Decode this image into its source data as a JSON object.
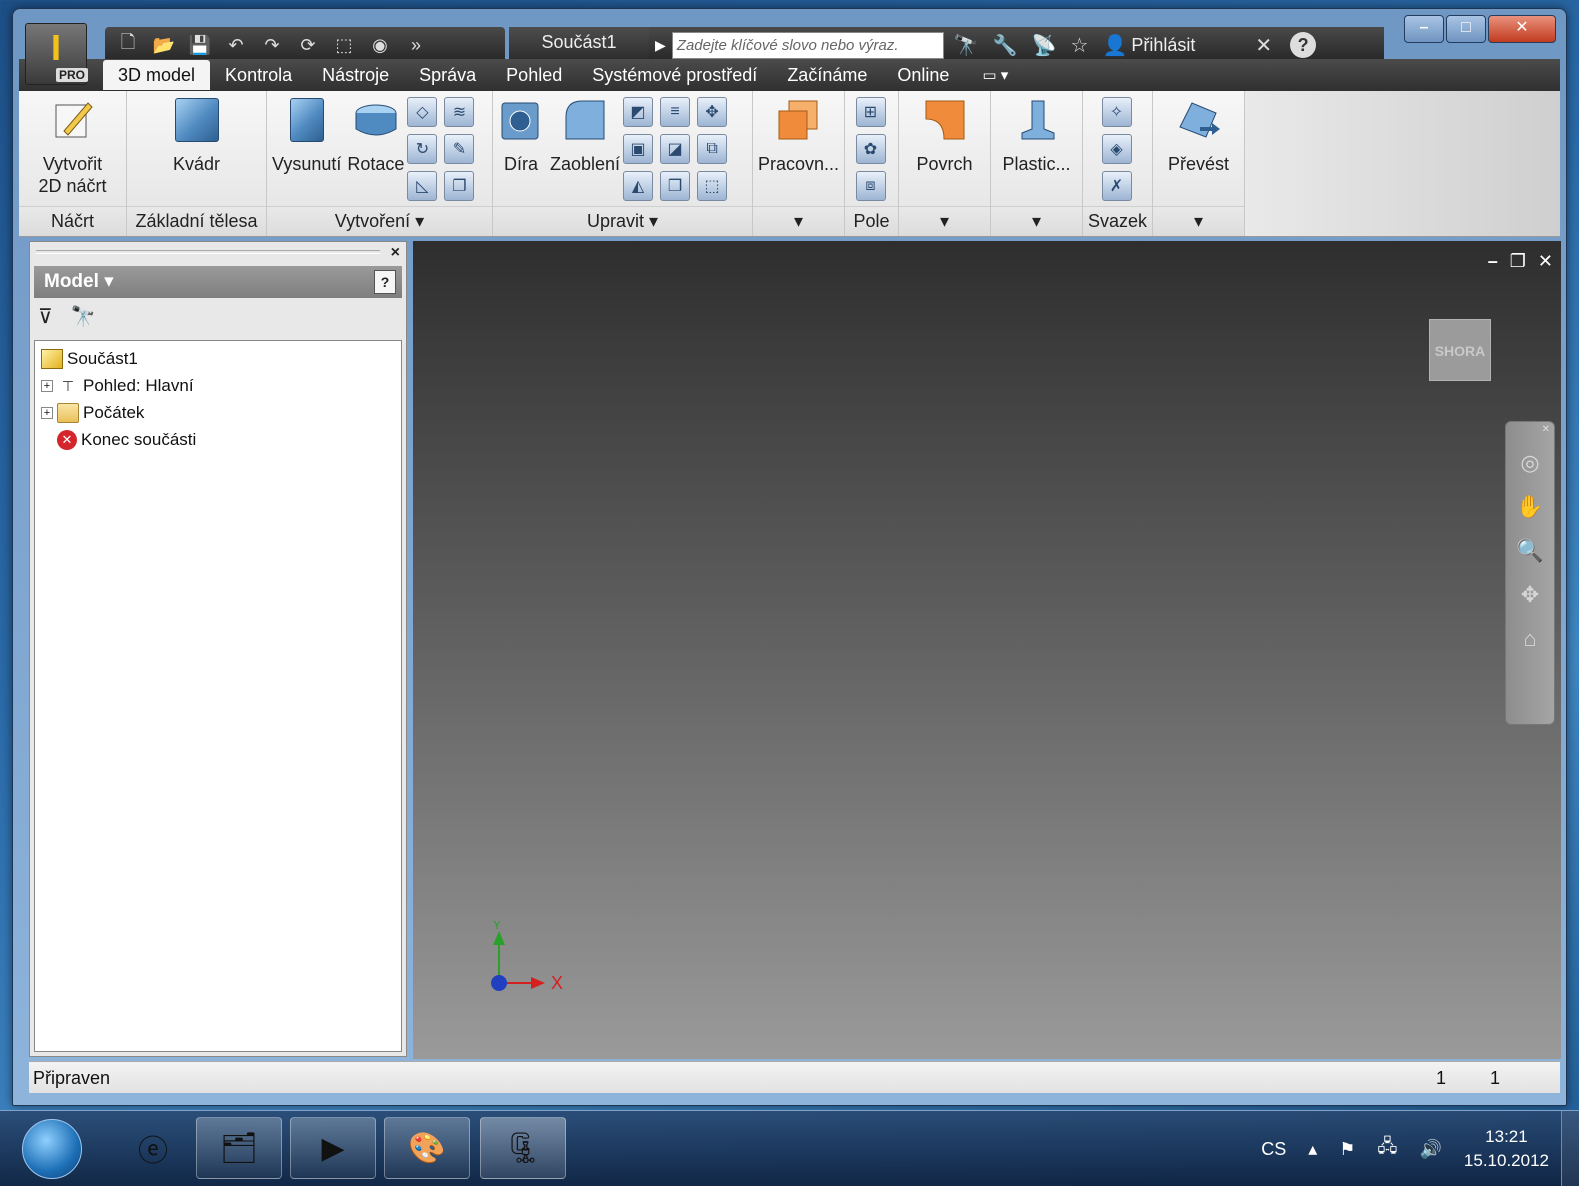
{
  "window": {
    "document_title": "Součást1",
    "app_pro_badge": "PRO",
    "search": {
      "placeholder": "Zadejte klíčové slovo nebo výraz."
    },
    "signin_label": "Přihlásit"
  },
  "tabs": [
    {
      "label": "3D model",
      "active": true
    },
    {
      "label": "Kontrola"
    },
    {
      "label": "Nástroje"
    },
    {
      "label": "Správa"
    },
    {
      "label": "Pohled"
    },
    {
      "label": "Systémové prostředí"
    },
    {
      "label": "Začínáme"
    },
    {
      "label": "Online"
    }
  ],
  "ribbon": {
    "groups": {
      "sketch": {
        "label": "Náčrt",
        "button_line1": "Vytvořit",
        "button_line2": "2D náčrt"
      },
      "primitives": {
        "label": "Základní tělesa",
        "button": "Kvádr"
      },
      "create": {
        "label": "Vytvoření ▾",
        "extrude": "Vysunutí",
        "revolve": "Rotace"
      },
      "modify": {
        "label": "Upravit ▾",
        "hole": "Díra",
        "fillet": "Zaoblení"
      },
      "work": {
        "button": "Pracovn..."
      },
      "pattern": {
        "label": "Pole"
      },
      "surface": {
        "button": "Povrch"
      },
      "plastic": {
        "button": "Plastic..."
      },
      "harness": {
        "label": "Svazek"
      },
      "convert": {
        "button": "Převést"
      }
    }
  },
  "browser": {
    "title": "Model ▾",
    "tree": [
      {
        "label": "Součást1",
        "icon": "part-icon",
        "level": 0
      },
      {
        "label": "Pohled: Hlavní",
        "icon": "view-icon",
        "level": 1,
        "expandable": true
      },
      {
        "label": "Počátek",
        "icon": "folder-icon",
        "level": 1,
        "expandable": true
      },
      {
        "label": "Konec součásti",
        "icon": "end-of-part-icon",
        "level": 1
      }
    ]
  },
  "viewport": {
    "viewcube_label": "SHORA",
    "triad_x": "X",
    "triad_y": "Y"
  },
  "statusbar": {
    "text": "Připraven",
    "num1": "1",
    "num2": "1"
  },
  "taskbar": {
    "language": "CS",
    "time": "13:21",
    "date": "15.10.2012"
  },
  "colors": {
    "tab_bar": "#303030",
    "viewport_top": "#2e2e2e",
    "viewport_bottom": "#9a9a9a",
    "accent_orange": "#f08b3c",
    "axis_x": "#d42020",
    "axis_y": "#2aa02a",
    "axis_z": "#2040c0"
  }
}
